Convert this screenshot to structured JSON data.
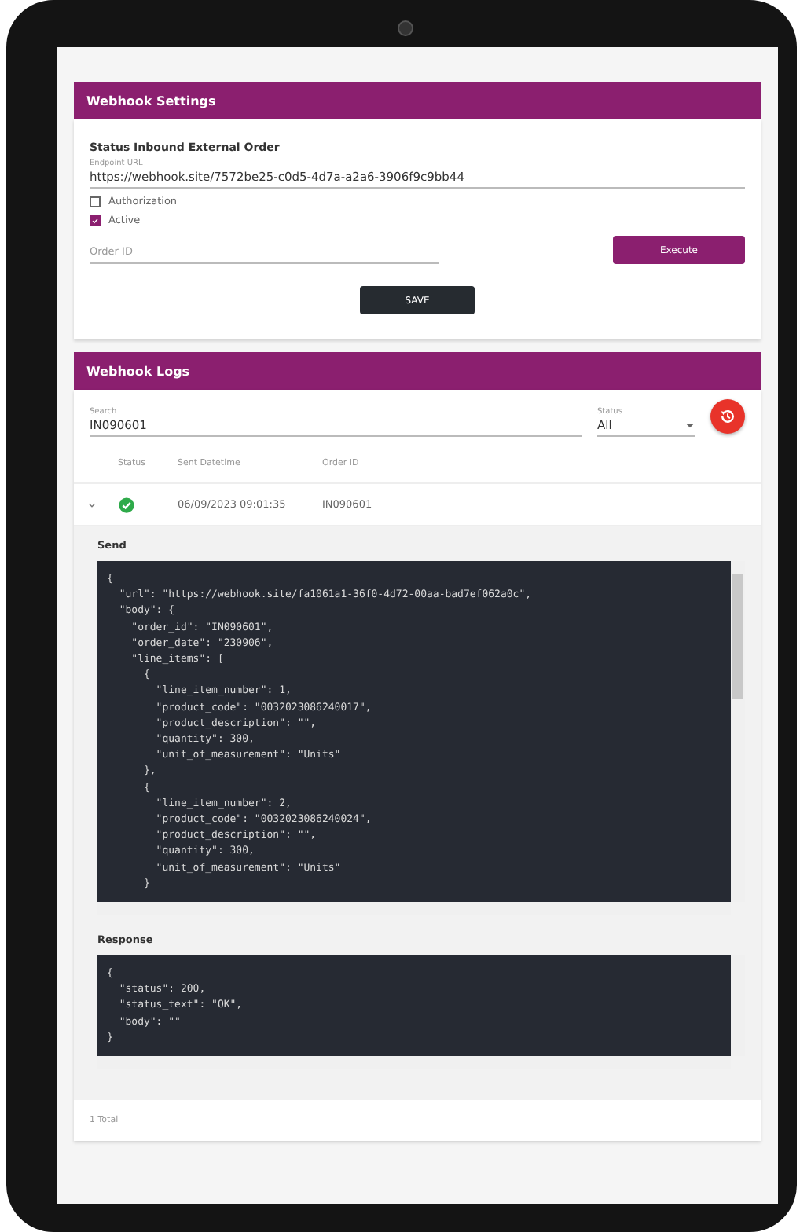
{
  "settings": {
    "title": "Webhook Settings",
    "section_title": "Status Inbound External Order",
    "endpoint": {
      "label": "Endpoint URL",
      "value": "https://webhook.site/7572be25-c0d5-4d7a-a2a6-3906f9c9bb44"
    },
    "checkboxes": [
      {
        "label": "Authorization",
        "checked": false
      },
      {
        "label": "Active",
        "checked": true
      }
    ],
    "order_id": {
      "placeholder": "Order ID"
    },
    "execute_button": "Execute",
    "save_button": "SAVE"
  },
  "logs": {
    "title": "Webhook Logs",
    "search": {
      "label": "Search",
      "value": "IN090601"
    },
    "status_filter": {
      "label": "Status",
      "value": "All"
    },
    "columns": [
      "Status",
      "Sent Datetime",
      "Order ID"
    ],
    "rows": [
      {
        "succeeded": true,
        "expanded": true,
        "sent": "06/09/2023 09:01:35",
        "order_id": "IN090601",
        "send_title": "Send",
        "send_lines": [
          "{",
          "  \"url\": \"https://webhook.site/fa1061a1-36f0-4d72-00aa-bad7ef062a0c\",",
          "  \"body\": {",
          "    \"order_id\": \"IN090601\",",
          "    \"order_date\": \"230906\",",
          "    \"line_items\": [",
          "      {",
          "        \"line_item_number\": 1,",
          "        \"product_code\": \"0032023086240017\",",
          "        \"product_description\": \"\",",
          "        \"quantity\": 300,",
          "        \"unit_of_measurement\": \"Units\"",
          "      },",
          "      {",
          "        \"line_item_number\": 2,",
          "        \"product_code\": \"0032023086240024\",",
          "        \"product_description\": \"\",",
          "        \"quantity\": 300,",
          "        \"unit_of_measurement\": \"Units\"",
          "      }"
        ],
        "response_title": "Response",
        "response_lines": [
          "{",
          "  \"status\": 200,",
          "  \"status_text\": \"OK\",",
          "  \"body\": \"\"",
          "}"
        ]
      }
    ],
    "total": "1 Total"
  }
}
